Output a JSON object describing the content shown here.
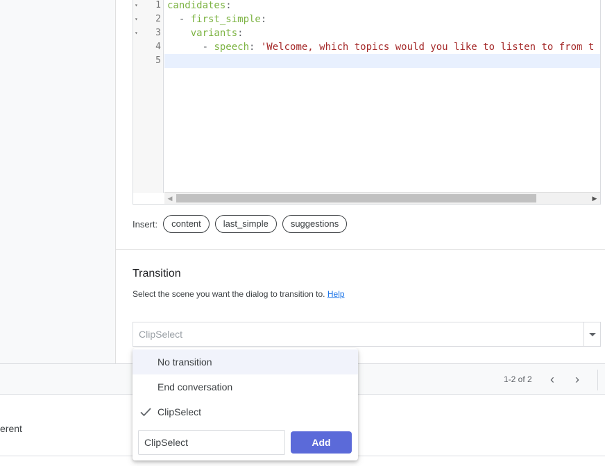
{
  "editor": {
    "line_numbers": [
      "1",
      "2",
      "3",
      "4",
      "5"
    ],
    "lines": [
      {
        "indent": "",
        "dash": "",
        "key": "candidates",
        "colon": ":",
        "value": ""
      },
      {
        "indent": "  ",
        "dash": "- ",
        "key": "first_simple",
        "colon": ":",
        "value": ""
      },
      {
        "indent": "    ",
        "dash": "",
        "key": "variants",
        "colon": ":",
        "value": ""
      },
      {
        "indent": "      ",
        "dash": "- ",
        "key": "speech",
        "colon": ": ",
        "value": "'Welcome, which topics would you like to listen to from t"
      },
      {
        "indent": "",
        "dash": "",
        "key": "",
        "colon": "",
        "value": ""
      }
    ],
    "fold_markers": [
      "▾",
      "▾",
      "▾"
    ]
  },
  "insert": {
    "label": "Insert:",
    "chips": [
      "content",
      "last_simple",
      "suggestions"
    ]
  },
  "transition": {
    "title": "Transition",
    "description": "Select the scene you want the dialog to transition to.",
    "help_link": "Help",
    "selected": "ClipSelect"
  },
  "dropdown": {
    "options": [
      "No transition",
      "End conversation",
      "ClipSelect"
    ],
    "checked_option": "ClipSelect",
    "input_value": "ClipSelect",
    "add_label": "Add"
  },
  "pager": {
    "range": "1-2 of 2",
    "prev": "‹",
    "next": "›"
  },
  "row": {
    "text": "erent"
  },
  "colors": {
    "accent": "#5b6ad9",
    "link": "#1a73e8",
    "yaml_key": "#7cb342",
    "yaml_string": "#a52a2a"
  }
}
